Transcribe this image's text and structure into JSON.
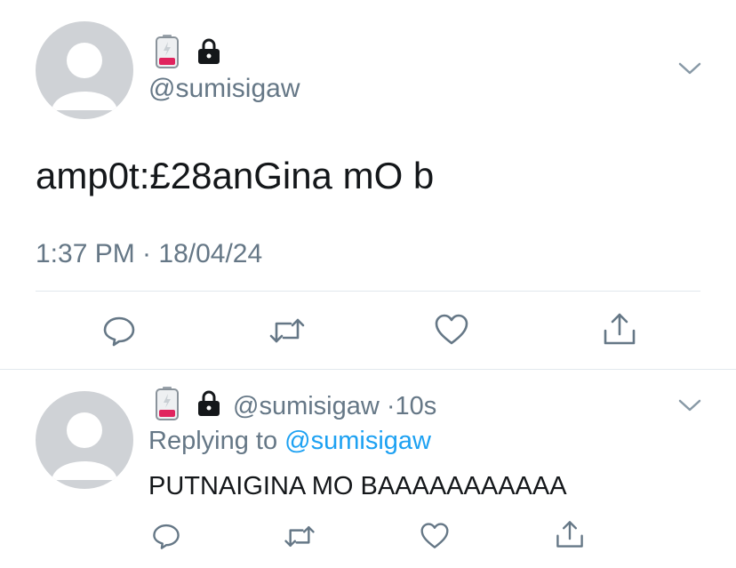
{
  "main_tweet": {
    "handle": "@sumisigaw",
    "text": "amp0t:£28anGina mO b",
    "timestamp": "1:37 PM · 18/04/24",
    "icons": [
      "battery-empty-icon",
      "lock-icon",
      "chevron-down-icon"
    ],
    "actions": [
      "reply-icon",
      "retweet-icon",
      "like-icon",
      "share-icon"
    ]
  },
  "reply_tweet": {
    "handle": "@sumisigaw",
    "separator": "·",
    "time": "10s",
    "replying_label": "Replying to",
    "replying_handle": "@sumisigaw",
    "text": "PUTNAIGINA MO BAAAAAAAAAAA",
    "icons": [
      "battery-empty-icon",
      "lock-icon",
      "chevron-down-icon"
    ],
    "actions": [
      "reply-icon",
      "retweet-icon",
      "like-icon",
      "share-icon"
    ]
  },
  "colors": {
    "text": "#14171a",
    "secondary": "#657786",
    "link": "#1da1f2",
    "divider": "#e1e8ed",
    "battery": "#e0245e"
  }
}
